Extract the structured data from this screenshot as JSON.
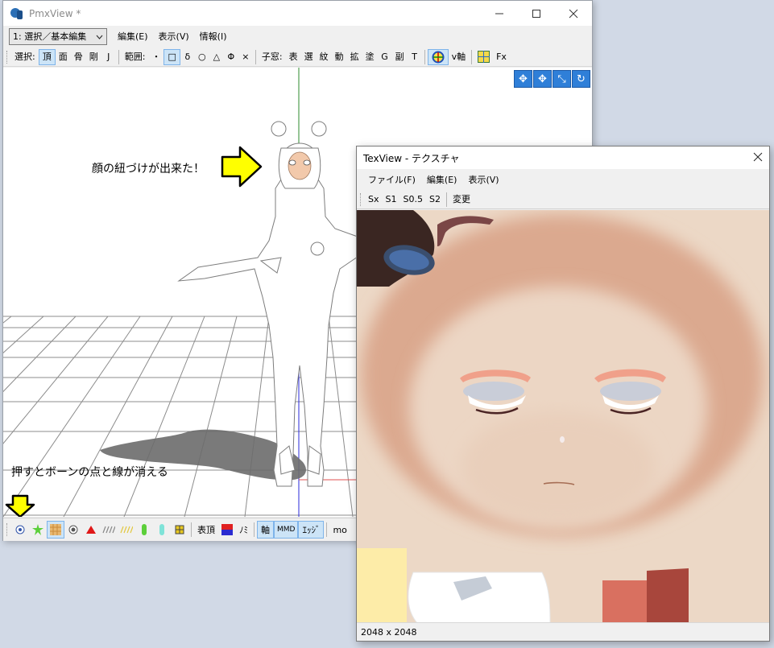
{
  "pmx": {
    "title": "PmxView *",
    "mode_select": "1: 選択／基本編集",
    "menus": [
      "編集(E)",
      "表示(V)",
      "情報(I)"
    ],
    "toolbar": {
      "select_label": "選択:",
      "select_items": [
        "頂",
        "面",
        "骨",
        "剛",
        "J"
      ],
      "range_label": "範囲:",
      "range_items": [
        "・",
        "□",
        "δ",
        "○",
        "△",
        "Φ",
        "×"
      ],
      "child_label": "子窓:",
      "child_items": [
        "表",
        "選",
        "紋",
        "動",
        "拡",
        "塗",
        "G",
        "副",
        "T"
      ],
      "axis_label": "v軸",
      "fx_label": "Fx"
    },
    "annotations": {
      "face_link": "顔の紐づけが出来た！",
      "press_hint": "押すとボーンの点と線が消える"
    },
    "bottombar": {
      "vertex_label": "表頂",
      "mi_label": "ﾉﾐ",
      "axis_label": "軸",
      "mmd_label": "MMD",
      "edge_label": "ｴｯｼﾞ",
      "extra_text": "mo"
    }
  },
  "tex": {
    "title": "TexView - テクスチャ",
    "menus": [
      "ファイル(F)",
      "編集(E)",
      "表示(V)"
    ],
    "toolbar": [
      "Sx",
      "S1",
      "S0.5",
      "S2"
    ],
    "change_label": "変更",
    "status": "2048 x 2048"
  },
  "colors": {
    "arrow_yellow": "#ffff00",
    "skin": "#ebd6c4",
    "skin_shadow": "#d9a88c",
    "active_blue": "#cce4f7"
  }
}
